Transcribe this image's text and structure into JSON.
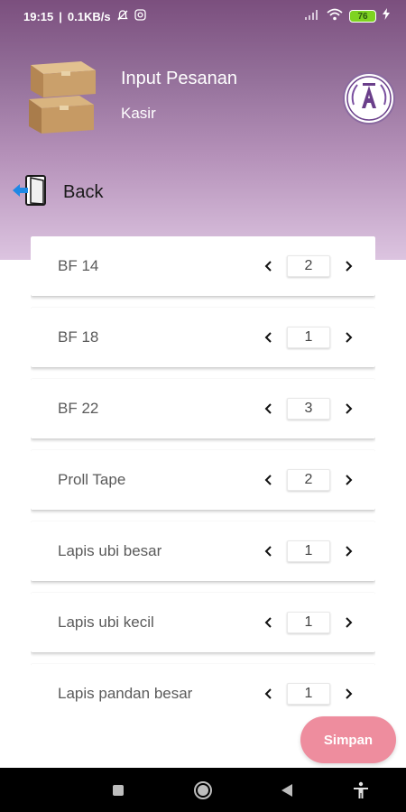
{
  "status_bar": {
    "time": "19:15",
    "network_speed": "0.1KB/s",
    "battery_level": "76",
    "icons": [
      "mute-bell-icon",
      "instagram-icon",
      "signal-icon",
      "wifi-icon",
      "battery-icon",
      "charging-icon"
    ]
  },
  "header": {
    "title": "Input Pesanan",
    "subtitle": "Kasir",
    "back_label": "Back",
    "gradient_colors": [
      "#7b4f7e",
      "#b591b9",
      "#dcc4e0"
    ]
  },
  "items": [
    {
      "name": "BF 14",
      "qty": "2"
    },
    {
      "name": "BF 18",
      "qty": "1"
    },
    {
      "name": "BF 22",
      "qty": "3"
    },
    {
      "name": "Proll Tape",
      "qty": "2"
    },
    {
      "name": "Lapis ubi besar",
      "qty": "1"
    },
    {
      "name": "Lapis ubi kecil",
      "qty": "1"
    },
    {
      "name": "Lapis pandan besar",
      "qty": "1"
    }
  ],
  "save_button": {
    "label": "Simpan",
    "color": "#ee8d9e"
  },
  "nav_bar": {
    "icons": [
      "recents-square-icon",
      "home-circle-icon",
      "back-triangle-icon",
      "accessibility-icon"
    ]
  }
}
